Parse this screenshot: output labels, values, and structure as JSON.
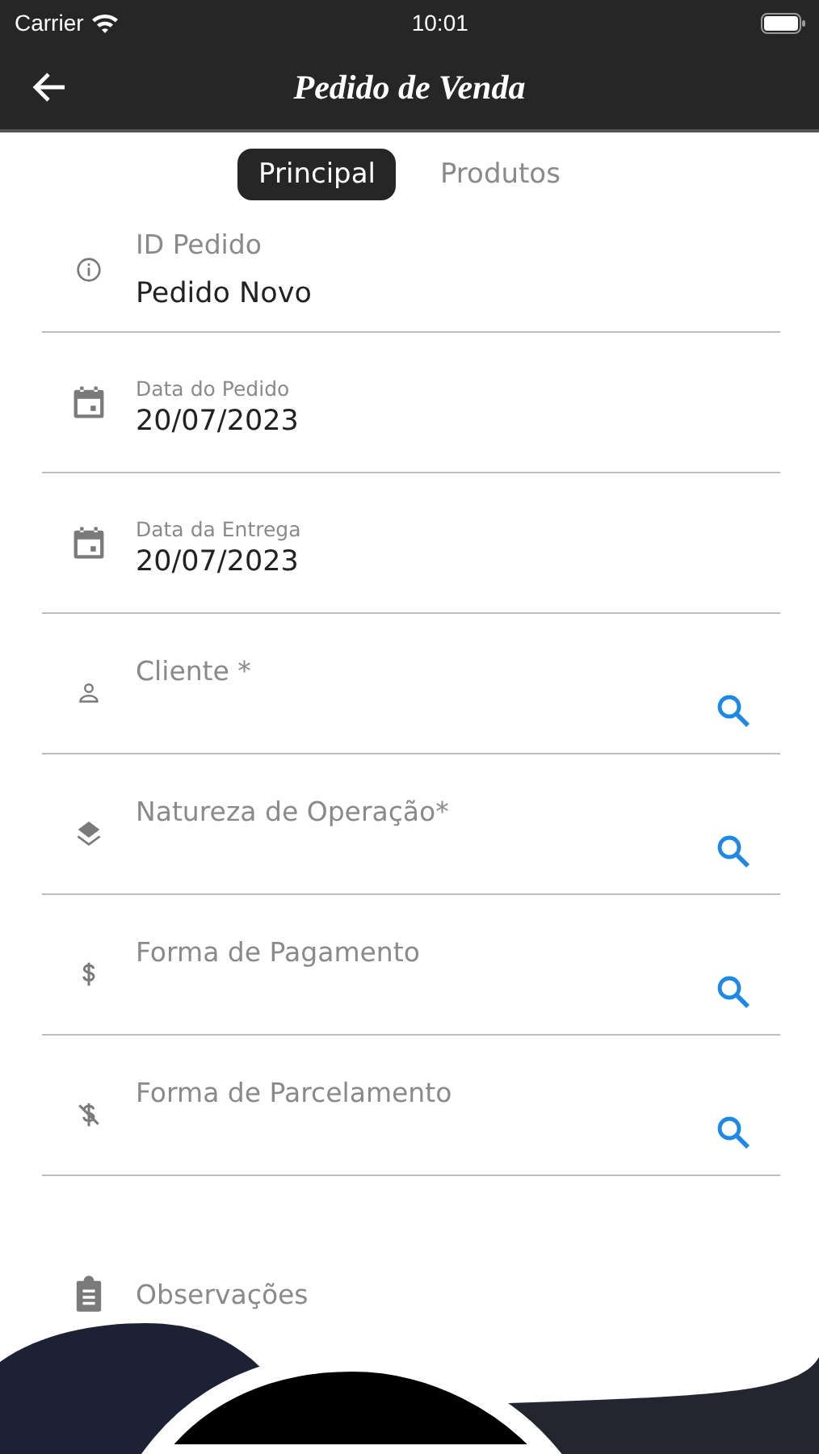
{
  "status_bar": {
    "carrier": "Carrier",
    "time": "10:01"
  },
  "nav": {
    "title": "Pedido de Venda"
  },
  "tabs": [
    {
      "label": "Principal",
      "selected": true
    },
    {
      "label": "Produtos",
      "selected": false
    }
  ],
  "fields": [
    {
      "kind": "text",
      "label": "ID Pedido",
      "value": "Pedido Novo"
    },
    {
      "kind": "date",
      "label": "Data do Pedido",
      "value": "20/07/2023"
    },
    {
      "kind": "date",
      "label": "Data da Entrega",
      "value": "20/07/2023"
    },
    {
      "kind": "lookup",
      "label": "Cliente *"
    },
    {
      "kind": "lookup",
      "label": "Natureza de Operação*"
    },
    {
      "kind": "lookup",
      "label": "Forma de Pagamento"
    },
    {
      "kind": "lookup",
      "label": "Forma de Parcelamento"
    },
    {
      "kind": "notes",
      "label": "Observações"
    }
  ]
}
